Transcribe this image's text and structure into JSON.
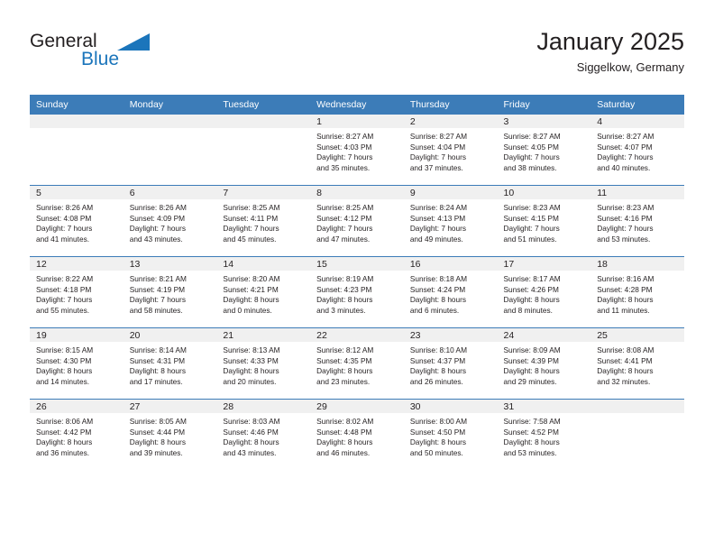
{
  "brand": {
    "line1": "General",
    "line2": "Blue",
    "triangle_color": "#1b75bb"
  },
  "header": {
    "title": "January 2025",
    "subtitle": "Siggelkow, Germany",
    "accent_color": "#3c7cb8"
  },
  "weekday_headers": [
    "Sunday",
    "Monday",
    "Tuesday",
    "Wednesday",
    "Thursday",
    "Friday",
    "Saturday"
  ],
  "labels": {
    "sunrise": "Sunrise:",
    "sunset": "Sunset:",
    "daylight": "Daylight:"
  },
  "weeks": [
    [
      {
        "empty": true
      },
      {
        "empty": true
      },
      {
        "empty": true
      },
      {
        "day": "1",
        "sunrise": "Sunrise: 8:27 AM",
        "sunset": "Sunset: 4:03 PM",
        "daylight1": "Daylight: 7 hours",
        "daylight2": "and 35 minutes."
      },
      {
        "day": "2",
        "sunrise": "Sunrise: 8:27 AM",
        "sunset": "Sunset: 4:04 PM",
        "daylight1": "Daylight: 7 hours",
        "daylight2": "and 37 minutes."
      },
      {
        "day": "3",
        "sunrise": "Sunrise: 8:27 AM",
        "sunset": "Sunset: 4:05 PM",
        "daylight1": "Daylight: 7 hours",
        "daylight2": "and 38 minutes."
      },
      {
        "day": "4",
        "sunrise": "Sunrise: 8:27 AM",
        "sunset": "Sunset: 4:07 PM",
        "daylight1": "Daylight: 7 hours",
        "daylight2": "and 40 minutes."
      }
    ],
    [
      {
        "day": "5",
        "sunrise": "Sunrise: 8:26 AM",
        "sunset": "Sunset: 4:08 PM",
        "daylight1": "Daylight: 7 hours",
        "daylight2": "and 41 minutes."
      },
      {
        "day": "6",
        "sunrise": "Sunrise: 8:26 AM",
        "sunset": "Sunset: 4:09 PM",
        "daylight1": "Daylight: 7 hours",
        "daylight2": "and 43 minutes."
      },
      {
        "day": "7",
        "sunrise": "Sunrise: 8:25 AM",
        "sunset": "Sunset: 4:11 PM",
        "daylight1": "Daylight: 7 hours",
        "daylight2": "and 45 minutes."
      },
      {
        "day": "8",
        "sunrise": "Sunrise: 8:25 AM",
        "sunset": "Sunset: 4:12 PM",
        "daylight1": "Daylight: 7 hours",
        "daylight2": "and 47 minutes."
      },
      {
        "day": "9",
        "sunrise": "Sunrise: 8:24 AM",
        "sunset": "Sunset: 4:13 PM",
        "daylight1": "Daylight: 7 hours",
        "daylight2": "and 49 minutes."
      },
      {
        "day": "10",
        "sunrise": "Sunrise: 8:23 AM",
        "sunset": "Sunset: 4:15 PM",
        "daylight1": "Daylight: 7 hours",
        "daylight2": "and 51 minutes."
      },
      {
        "day": "11",
        "sunrise": "Sunrise: 8:23 AM",
        "sunset": "Sunset: 4:16 PM",
        "daylight1": "Daylight: 7 hours",
        "daylight2": "and 53 minutes."
      }
    ],
    [
      {
        "day": "12",
        "sunrise": "Sunrise: 8:22 AM",
        "sunset": "Sunset: 4:18 PM",
        "daylight1": "Daylight: 7 hours",
        "daylight2": "and 55 minutes."
      },
      {
        "day": "13",
        "sunrise": "Sunrise: 8:21 AM",
        "sunset": "Sunset: 4:19 PM",
        "daylight1": "Daylight: 7 hours",
        "daylight2": "and 58 minutes."
      },
      {
        "day": "14",
        "sunrise": "Sunrise: 8:20 AM",
        "sunset": "Sunset: 4:21 PM",
        "daylight1": "Daylight: 8 hours",
        "daylight2": "and 0 minutes."
      },
      {
        "day": "15",
        "sunrise": "Sunrise: 8:19 AM",
        "sunset": "Sunset: 4:23 PM",
        "daylight1": "Daylight: 8 hours",
        "daylight2": "and 3 minutes."
      },
      {
        "day": "16",
        "sunrise": "Sunrise: 8:18 AM",
        "sunset": "Sunset: 4:24 PM",
        "daylight1": "Daylight: 8 hours",
        "daylight2": "and 6 minutes."
      },
      {
        "day": "17",
        "sunrise": "Sunrise: 8:17 AM",
        "sunset": "Sunset: 4:26 PM",
        "daylight1": "Daylight: 8 hours",
        "daylight2": "and 8 minutes."
      },
      {
        "day": "18",
        "sunrise": "Sunrise: 8:16 AM",
        "sunset": "Sunset: 4:28 PM",
        "daylight1": "Daylight: 8 hours",
        "daylight2": "and 11 minutes."
      }
    ],
    [
      {
        "day": "19",
        "sunrise": "Sunrise: 8:15 AM",
        "sunset": "Sunset: 4:30 PM",
        "daylight1": "Daylight: 8 hours",
        "daylight2": "and 14 minutes."
      },
      {
        "day": "20",
        "sunrise": "Sunrise: 8:14 AM",
        "sunset": "Sunset: 4:31 PM",
        "daylight1": "Daylight: 8 hours",
        "daylight2": "and 17 minutes."
      },
      {
        "day": "21",
        "sunrise": "Sunrise: 8:13 AM",
        "sunset": "Sunset: 4:33 PM",
        "daylight1": "Daylight: 8 hours",
        "daylight2": "and 20 minutes."
      },
      {
        "day": "22",
        "sunrise": "Sunrise: 8:12 AM",
        "sunset": "Sunset: 4:35 PM",
        "daylight1": "Daylight: 8 hours",
        "daylight2": "and 23 minutes."
      },
      {
        "day": "23",
        "sunrise": "Sunrise: 8:10 AM",
        "sunset": "Sunset: 4:37 PM",
        "daylight1": "Daylight: 8 hours",
        "daylight2": "and 26 minutes."
      },
      {
        "day": "24",
        "sunrise": "Sunrise: 8:09 AM",
        "sunset": "Sunset: 4:39 PM",
        "daylight1": "Daylight: 8 hours",
        "daylight2": "and 29 minutes."
      },
      {
        "day": "25",
        "sunrise": "Sunrise: 8:08 AM",
        "sunset": "Sunset: 4:41 PM",
        "daylight1": "Daylight: 8 hours",
        "daylight2": "and 32 minutes."
      }
    ],
    [
      {
        "day": "26",
        "sunrise": "Sunrise: 8:06 AM",
        "sunset": "Sunset: 4:42 PM",
        "daylight1": "Daylight: 8 hours",
        "daylight2": "and 36 minutes."
      },
      {
        "day": "27",
        "sunrise": "Sunrise: 8:05 AM",
        "sunset": "Sunset: 4:44 PM",
        "daylight1": "Daylight: 8 hours",
        "daylight2": "and 39 minutes."
      },
      {
        "day": "28",
        "sunrise": "Sunrise: 8:03 AM",
        "sunset": "Sunset: 4:46 PM",
        "daylight1": "Daylight: 8 hours",
        "daylight2": "and 43 minutes."
      },
      {
        "day": "29",
        "sunrise": "Sunrise: 8:02 AM",
        "sunset": "Sunset: 4:48 PM",
        "daylight1": "Daylight: 8 hours",
        "daylight2": "and 46 minutes."
      },
      {
        "day": "30",
        "sunrise": "Sunrise: 8:00 AM",
        "sunset": "Sunset: 4:50 PM",
        "daylight1": "Daylight: 8 hours",
        "daylight2": "and 50 minutes."
      },
      {
        "day": "31",
        "sunrise": "Sunrise: 7:58 AM",
        "sunset": "Sunset: 4:52 PM",
        "daylight1": "Daylight: 8 hours",
        "daylight2": "and 53 minutes."
      },
      {
        "empty": true
      }
    ]
  ]
}
